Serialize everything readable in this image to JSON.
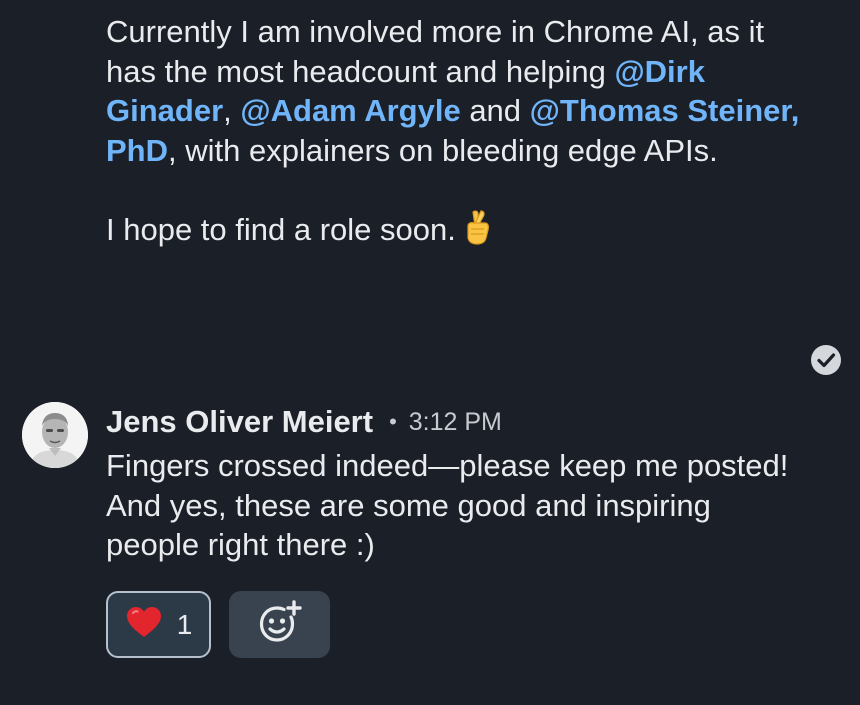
{
  "previous_message": {
    "line1": "Currently I am involved more in Chrome AI, as it has the most headcount and helping ",
    "mention1": "@Dirk Ginader",
    "sep1": ", ",
    "mention2": "@Adam Argyle",
    "sep2": " and ",
    "mention3": "@Thomas Steiner, PhD",
    "line2": ", with explainers on bleeding edge APIs.",
    "paragraph2": "I hope to find a role soon.",
    "emoji_icon": "crossed-fingers-icon",
    "read_receipt_icon": "check-circle-icon"
  },
  "message": {
    "sender": "Jens Oliver Meiert",
    "separator": "•",
    "time": "3:12 PM",
    "text": "Fingers crossed indeed—please keep me posted! And yes, these are some good and inspiring people right there :)",
    "avatar_icon": "avatar"
  },
  "reactions": [
    {
      "icon": "red-heart-icon",
      "count": "1"
    }
  ],
  "add_reaction_icon": "add-reaction-smiley-icon",
  "colors": {
    "background": "#1b1f27",
    "text": "#e9ebee",
    "mention": "#70b5f9",
    "reaction_bg": "#2c3a47",
    "reaction_border": "#b6c1cd",
    "add_reaction_bg": "#38434f"
  }
}
